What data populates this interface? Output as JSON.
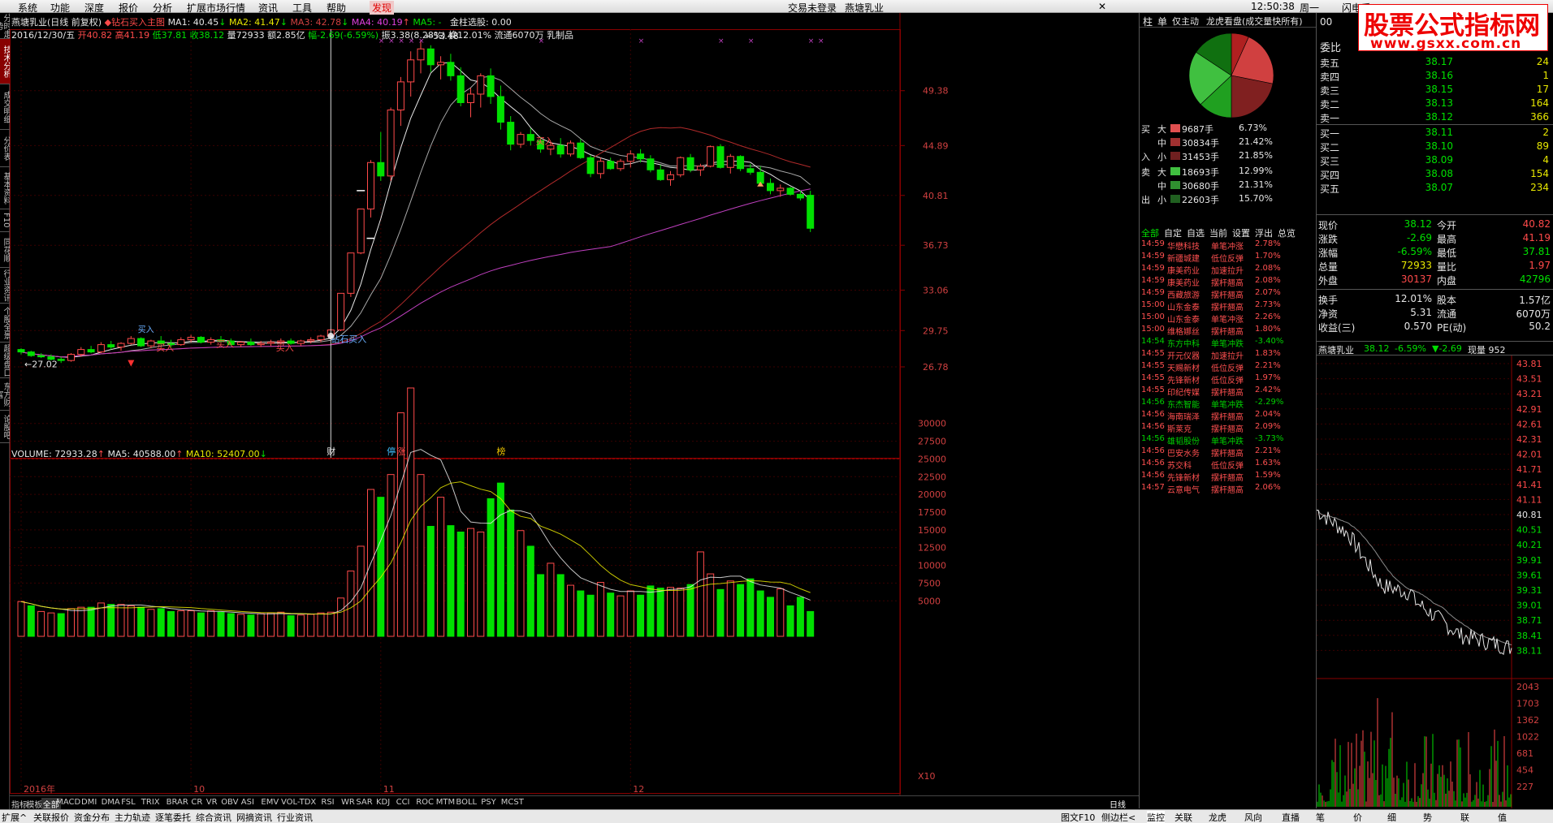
{
  "menu": {
    "items": [
      "系统",
      "功能",
      "深度",
      "报价",
      "分析",
      "扩展市场行情",
      "资讯",
      "工具",
      "帮助",
      "发现"
    ],
    "active": "发现",
    "login_status": "交易未登录",
    "stock_name": "燕塘乳业",
    "time": "12:50:38",
    "weekday": "周一",
    "right_label": "闪电手"
  },
  "watermark": {
    "title": "股票公式指标网",
    "url": "www.gsxx.com.cn"
  },
  "left_tabs": [
    "分时走势",
    "技术分析",
    "成交明细",
    "分价表",
    "基本资料",
    "F10",
    "同花顺",
    "行业资讯",
    "个股全景",
    "超级盘口",
    "东方财富",
    "论股吧"
  ],
  "chart_header": {
    "name": "燕塘乳业(日线 前复权)",
    "indicator": "钻石买入主图",
    "ma1": "MA1: 40.45",
    "ma2": "MA2: 41.47",
    "ma3": "MA3: 42.78",
    "ma4": "MA4: 40.19",
    "ma5": "MA5: -",
    "extra": "金柱选股: 0.00",
    "line2_date": "2016/12/30/五",
    "line2_open": "开40.82",
    "line2_high": "高41.19",
    "line2_low": "低37.81",
    "line2_close": "收38.12",
    "line2_vol": "量72933",
    "line2_amt": "额2.85亿",
    "line2_chg": "幅-2.69(-6.59%)",
    "line2_amp": "振3.38(8.28%)",
    "line2_turn": "换12.01%",
    "line2_float": "流通6070万",
    "line2_sector": "乳制品"
  },
  "volume_header": {
    "vol": "VOLUME: 72933.28",
    "ma5": "MA5: 40588.00",
    "ma10": "MA10: 52407.00"
  },
  "price_annotations": {
    "high": "53.48",
    "low": "27.02",
    "diamond": "钻石买入",
    "buy1": "买入",
    "buy2": "买入",
    "buy3": "买入",
    "buy4": "买入",
    "buy5": "买入",
    "cai": "财",
    "ting": "停",
    "zhang": "涨",
    "bang": "榜"
  },
  "date_labels": [
    "2016年",
    "10",
    "11",
    "12"
  ],
  "x10": "X10",
  "chart_data": [
    {
      "type": "candlestick",
      "title": "燕塘乳业(日线 前复权)",
      "ylim": [
        26.78,
        53.48
      ],
      "yticks": [
        49.38,
        44.89,
        40.81,
        36.73,
        33.06,
        29.75,
        26.78
      ],
      "x": [
        "2016-09",
        "10",
        "11",
        "12"
      ],
      "candles_ohlc": [
        [
          28.2,
          28.3,
          27.8,
          28.0
        ],
        [
          28.0,
          28.1,
          27.6,
          27.7
        ],
        [
          27.7,
          27.9,
          27.5,
          27.6
        ],
        [
          27.6,
          27.8,
          27.3,
          27.4
        ],
        [
          27.4,
          27.6,
          27.1,
          27.3
        ],
        [
          27.3,
          27.9,
          27.2,
          27.8
        ],
        [
          27.8,
          28.4,
          27.6,
          28.2
        ],
        [
          28.2,
          28.5,
          27.9,
          28.0
        ],
        [
          28.0,
          28.8,
          27.9,
          28.6
        ],
        [
          28.6,
          28.9,
          28.2,
          28.4
        ],
        [
          28.4,
          28.8,
          28.1,
          28.7
        ],
        [
          28.7,
          29.3,
          28.6,
          29.1
        ],
        [
          29.1,
          29.2,
          28.4,
          28.5
        ],
        [
          28.5,
          29.0,
          28.3,
          28.9
        ],
        [
          28.9,
          29.3,
          28.6,
          28.7
        ],
        [
          28.7,
          29.0,
          28.4,
          28.6
        ],
        [
          28.6,
          29.2,
          28.5,
          29.0
        ],
        [
          29.0,
          29.4,
          28.8,
          29.2
        ],
        [
          29.2,
          29.3,
          28.7,
          28.8
        ],
        [
          28.8,
          29.2,
          28.6,
          29.0
        ],
        [
          29.0,
          29.3,
          28.7,
          28.9
        ],
        [
          28.9,
          29.1,
          28.5,
          28.6
        ],
        [
          28.6,
          28.9,
          28.4,
          28.8
        ],
        [
          28.8,
          29.1,
          28.5,
          28.6
        ],
        [
          28.6,
          28.9,
          28.4,
          28.7
        ],
        [
          28.7,
          29.0,
          28.5,
          28.8
        ],
        [
          28.8,
          29.1,
          28.6,
          28.9
        ],
        [
          28.9,
          29.1,
          28.6,
          28.7
        ],
        [
          28.7,
          29.0,
          28.5,
          28.9
        ],
        [
          28.9,
          29.2,
          28.7,
          29.0
        ],
        [
          29.0,
          29.4,
          28.8,
          29.3
        ],
        [
          29.3,
          29.9,
          29.1,
          29.8
        ],
        [
          29.8,
          32.8,
          29.7,
          32.8
        ],
        [
          32.8,
          36.1,
          32.5,
          36.1
        ],
        [
          36.1,
          39.7,
          36.0,
          39.7
        ],
        [
          39.7,
          43.7,
          39.0,
          43.5
        ],
        [
          43.5,
          46.0,
          42.0,
          42.4
        ],
        [
          42.4,
          48.0,
          42.0,
          47.8
        ],
        [
          47.8,
          50.5,
          46.5,
          50.1
        ],
        [
          50.1,
          52.6,
          48.9,
          51.9
        ],
        [
          51.9,
          53.48,
          50.8,
          52.8
        ],
        [
          52.8,
          53.1,
          50.9,
          51.5
        ],
        [
          51.5,
          52.2,
          50.3,
          51.7
        ],
        [
          51.7,
          52.4,
          50.2,
          50.6
        ],
        [
          50.6,
          51.3,
          48.1,
          48.4
        ],
        [
          48.4,
          49.6,
          47.2,
          49.1
        ],
        [
          49.1,
          50.8,
          48.0,
          50.6
        ],
        [
          50.6,
          51.2,
          48.3,
          48.9
        ],
        [
          48.9,
          49.8,
          46.2,
          46.8
        ],
        [
          46.8,
          47.3,
          44.5,
          45.0
        ],
        [
          45.0,
          46.0,
          44.7,
          45.8
        ],
        [
          45.8,
          46.3,
          44.9,
          45.3
        ],
        [
          45.3,
          45.6,
          44.3,
          44.6
        ],
        [
          44.6,
          45.2,
          44.1,
          44.9
        ],
        [
          44.9,
          45.5,
          43.9,
          44.2
        ],
        [
          44.2,
          45.3,
          44.0,
          45.1
        ],
        [
          45.1,
          45.4,
          43.8,
          43.9
        ],
        [
          43.9,
          44.1,
          42.3,
          42.6
        ],
        [
          42.6,
          43.9,
          42.2,
          43.6
        ],
        [
          43.6,
          43.9,
          42.9,
          43.0
        ],
        [
          43.0,
          43.8,
          42.8,
          43.6
        ],
        [
          43.6,
          44.5,
          43.1,
          44.2
        ],
        [
          44.2,
          44.6,
          43.5,
          43.8
        ],
        [
          43.8,
          44.1,
          42.7,
          42.9
        ],
        [
          42.9,
          43.3,
          42.0,
          42.1
        ],
        [
          42.1,
          42.8,
          41.6,
          42.5
        ],
        [
          42.5,
          44.0,
          42.3,
          43.9
        ],
        [
          43.9,
          44.2,
          42.7,
          42.9
        ],
        [
          42.9,
          43.4,
          42.4,
          43.2
        ],
        [
          43.2,
          44.9,
          43.1,
          44.8
        ],
        [
          44.8,
          45.0,
          43.0,
          43.1
        ],
        [
          43.1,
          44.2,
          42.6,
          44.0
        ],
        [
          44.0,
          44.1,
          42.8,
          43.0
        ],
        [
          43.0,
          43.4,
          42.5,
          42.7
        ],
        [
          42.7,
          43.2,
          41.7,
          41.8
        ],
        [
          41.8,
          42.2,
          40.9,
          41.2
        ],
        [
          41.2,
          41.7,
          40.7,
          41.4
        ],
        [
          41.4,
          41.5,
          40.8,
          40.9
        ],
        [
          40.9,
          41.2,
          40.4,
          40.6
        ],
        [
          40.82,
          41.19,
          37.81,
          38.12
        ]
      ]
    },
    {
      "type": "bar",
      "title": "VOLUME",
      "ylim": [
        0,
        35000
      ],
      "yticks": [
        5000,
        7500,
        10000,
        12500,
        15000,
        17500,
        20000,
        22500,
        25000,
        27500,
        30000
      ],
      "values": [
        4900,
        4300,
        3500,
        3300,
        3200,
        3900,
        4100,
        4100,
        4700,
        4500,
        4500,
        4300,
        4100,
        3800,
        3900,
        3500,
        3600,
        3600,
        3300,
        3600,
        3400,
        3200,
        3100,
        3000,
        3200,
        3300,
        3400,
        2900,
        3000,
        3100,
        3300,
        3400,
        5400,
        9200,
        12700,
        20700,
        19600,
        22800,
        31500,
        35000,
        22800,
        15500,
        19600,
        15600,
        14700,
        15200,
        14700,
        19400,
        21600,
        17800,
        14900,
        12700,
        8700,
        10300,
        8700,
        7200,
        6400,
        5800,
        7600,
        6100,
        5700,
        6400,
        5800,
        7100,
        6800,
        6900,
        6800,
        7300,
        11900,
        8800,
        6600,
        7800,
        7300,
        8100,
        6400,
        5500,
        6700,
        4300,
        5500,
        3500,
        4200,
        3700,
        6000,
        7200,
        7300
      ],
      "up_flags": [
        1,
        0,
        1,
        1,
        0,
        1,
        1,
        0,
        1,
        0,
        1,
        1,
        0,
        1,
        0,
        0,
        1,
        1,
        0,
        1,
        0,
        0,
        1,
        0,
        1,
        1,
        1,
        0,
        1,
        1,
        1,
        1,
        1,
        1,
        1,
        1,
        0,
        1,
        1,
        1,
        1,
        0,
        1,
        0,
        0,
        1,
        1,
        0,
        0,
        0,
        1,
        0,
        0,
        1,
        0,
        1,
        0,
        0,
        1,
        0,
        1,
        1,
        0,
        0,
        0,
        1,
        1,
        0,
        1,
        1,
        0,
        1,
        0,
        0,
        0,
        0,
        1,
        0,
        0,
        0,
        0,
        0,
        0,
        1,
        0,
        0
      ]
    }
  ],
  "side": {
    "tabs": [
      "柱",
      "单",
      "仅主动",
      "龙虎看盘(成交量快所有)"
    ],
    "pie_colors": [
      "#b02020",
      "#d04040",
      "#802020",
      "#20a020",
      "#40c040",
      "#107010"
    ],
    "flows": [
      {
        "dir": "买",
        "size": "大",
        "vol": "9687手",
        "pct": "6.73%",
        "color": "#e05050"
      },
      {
        "dir": "",
        "size": "中",
        "vol": "30834手",
        "pct": "21.42%",
        "color": "#a03030"
      },
      {
        "dir": "入",
        "size": "小",
        "vol": "31453手",
        "pct": "21.85%",
        "color": "#702020"
      },
      {
        "dir": "卖",
        "size": "大",
        "vol": "18693手",
        "pct": "12.99%",
        "color": "#40c040"
      },
      {
        "dir": "",
        "size": "中",
        "vol": "30680手",
        "pct": "21.31%",
        "color": "#309030"
      },
      {
        "dir": "出",
        "size": "小",
        "vol": "22603手",
        "pct": "15.70%",
        "color": "#206020"
      }
    ],
    "alert_tabs": [
      "全部",
      "自定",
      "自选",
      "当前",
      "设置",
      "浮出",
      "总览"
    ],
    "alerts": [
      {
        "time": "14:59",
        "name": "华懋科技",
        "type": "单笔冲涨",
        "pct": "2.78%",
        "up": true
      },
      {
        "time": "14:59",
        "name": "新疆城建",
        "type": "低位反弹",
        "pct": "1.70%",
        "up": true
      },
      {
        "time": "14:59",
        "name": "康美药业",
        "type": "加速拉升",
        "pct": "2.08%",
        "up": true
      },
      {
        "time": "14:59",
        "name": "康美药业",
        "type": "摆杆翘高",
        "pct": "2.08%",
        "up": true
      },
      {
        "time": "14:59",
        "name": "西藏旅游",
        "type": "摆杆翘高",
        "pct": "2.07%",
        "up": true
      },
      {
        "time": "15:00",
        "name": "山东金泰",
        "type": "摆杆翘高",
        "pct": "2.73%",
        "up": true
      },
      {
        "time": "15:00",
        "name": "山东金泰",
        "type": "单笔冲涨",
        "pct": "2.26%",
        "up": true
      },
      {
        "time": "15:00",
        "name": "维格娜丝",
        "type": "摆杆翘高",
        "pct": "1.80%",
        "up": true
      },
      {
        "time": "14:54",
        "name": "东方中科",
        "type": "单笔冲跌",
        "pct": "-3.40%",
        "up": false
      },
      {
        "time": "14:55",
        "name": "开元仪器",
        "type": "加速拉升",
        "pct": "1.83%",
        "up": true
      },
      {
        "time": "14:55",
        "name": "天赐新材",
        "type": "低位反弹",
        "pct": "2.21%",
        "up": true
      },
      {
        "time": "14:55",
        "name": "先锋新材",
        "type": "低位反弹",
        "pct": "1.97%",
        "up": true
      },
      {
        "time": "14:55",
        "name": "印纪传媒",
        "type": "摆杆翘高",
        "pct": "2.42%",
        "up": true
      },
      {
        "time": "14:56",
        "name": "东杰智能",
        "type": "单笔冲跌",
        "pct": "-2.29%",
        "up": false
      },
      {
        "time": "14:56",
        "name": "海南瑞泽",
        "type": "摆杆翘高",
        "pct": "2.04%",
        "up": true
      },
      {
        "time": "14:56",
        "name": "斯莱克",
        "type": "摆杆翘高",
        "pct": "2.09%",
        "up": true
      },
      {
        "time": "14:56",
        "name": "雄韬股份",
        "type": "单笔冲跌",
        "pct": "-3.73%",
        "up": false
      },
      {
        "time": "14:56",
        "name": "巴安水务",
        "type": "摆杆翘高",
        "pct": "2.21%",
        "up": true
      },
      {
        "time": "14:56",
        "name": "苏交科",
        "type": "低位反弹",
        "pct": "1.63%",
        "up": true
      },
      {
        "time": "14:56",
        "name": "先锋新材",
        "type": "摆杆翘高",
        "pct": "1.59%",
        "up": true
      },
      {
        "time": "14:57",
        "name": "云意电气",
        "type": "摆杆翘高",
        "pct": "2.06%",
        "up": true
      }
    ]
  },
  "orderbook": {
    "code": "00",
    "weibi_label": "委比",
    "sells": [
      {
        "label": "卖五",
        "price": "38.17",
        "vol": "24"
      },
      {
        "label": "卖四",
        "price": "38.16",
        "vol": "1"
      },
      {
        "label": "卖三",
        "price": "38.15",
        "vol": "17"
      },
      {
        "label": "卖二",
        "price": "38.13",
        "vol": "164"
      },
      {
        "label": "卖一",
        "price": "38.12",
        "vol": "366"
      }
    ],
    "buys": [
      {
        "label": "买一",
        "price": "38.11",
        "vol": "2"
      },
      {
        "label": "买二",
        "price": "38.10",
        "vol": "89"
      },
      {
        "label": "买三",
        "price": "38.09",
        "vol": "4"
      },
      {
        "label": "买四",
        "price": "38.08",
        "vol": "154"
      },
      {
        "label": "买五",
        "price": "38.07",
        "vol": "234"
      }
    ],
    "stats": [
      {
        "l1": "现价",
        "v1": "38.12",
        "c1": "g",
        "l2": "今开",
        "v2": "40.82",
        "c2": "r"
      },
      {
        "l1": "涨跌",
        "v1": "-2.69",
        "c1": "g",
        "l2": "最高",
        "v2": "41.19",
        "c2": "r"
      },
      {
        "l1": "涨幅",
        "v1": "-6.59%",
        "c1": "g",
        "l2": "最低",
        "v2": "37.81",
        "c2": "g"
      },
      {
        "l1": "总量",
        "v1": "72933",
        "c1": "y",
        "l2": "量比",
        "v2": "1.97",
        "c2": "r"
      },
      {
        "l1": "外盘",
        "v1": "30137",
        "c1": "r",
        "l2": "内盘",
        "v2": "42796",
        "c2": "g"
      }
    ],
    "stats2": [
      {
        "l1": "换手",
        "v1": "12.01%",
        "l2": "股本",
        "v2": "1.57亿"
      },
      {
        "l1": "净资",
        "v1": "5.31",
        "l2": "流通",
        "v2": "6070万"
      },
      {
        "l1": "收益(三)",
        "v1": "0.570",
        "l2": "PE(动)",
        "v2": "50.2"
      }
    ],
    "mini_header": {
      "name": "燕塘乳业",
      "price": "38.12",
      "chg": "-6.59%",
      "delta": "▼-2.69",
      "xl": "现量 952"
    },
    "mini_price_ticks": [
      "43.81",
      "43.51",
      "43.21",
      "42.91",
      "42.61",
      "42.31",
      "42.01",
      "41.71",
      "41.41",
      "41.11",
      "40.81",
      "40.51",
      "40.21",
      "39.91",
      "39.61",
      "39.31",
      "39.01",
      "38.71",
      "38.41",
      "38.11"
    ],
    "mini_vol_ticks": [
      "2043",
      "1703",
      "1362",
      "1022",
      "681",
      "454",
      "227"
    ]
  },
  "bottom_tabs": [
    "指标",
    "模板",
    "全部",
    "MACD",
    "DMI",
    "DMA",
    "FSL",
    "TRIX",
    "BRAR",
    "CR",
    "VR",
    "OBV",
    "ASI",
    "EMV",
    "VOL-TDX",
    "RSI",
    "WR",
    "SAR",
    "KDJ",
    "CCI",
    "ROC",
    "MTM",
    "BOLL",
    "PSY",
    "MCST"
  ],
  "bottom_right": "日线",
  "status_left": [
    "扩展^",
    "关联报价",
    "资金分布",
    "主力轨迹",
    "逐笔委托",
    "综合资讯",
    "网摘资讯",
    "行业资讯"
  ],
  "status_right": [
    "图文F10",
    "侧边栏<"
  ],
  "right_tabs": [
    "监控",
    "关联",
    "龙虎",
    "风向",
    "直播",
    "笔",
    "价",
    "细",
    "势",
    "联",
    "值"
  ]
}
